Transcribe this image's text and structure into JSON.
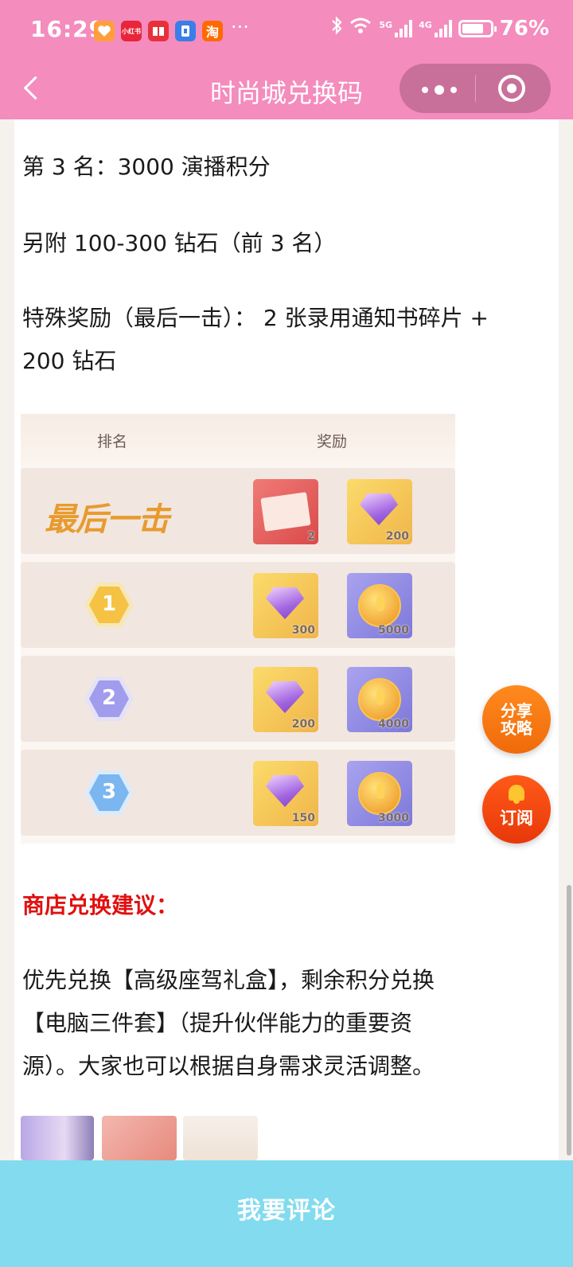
{
  "status_bar": {
    "time": "16:29",
    "apps": [
      "heart-app-icon",
      "xiaohongshu-app-icon",
      "book-app-icon",
      "doc-app-icon",
      "taobao-app-icon"
    ],
    "xiaohongshu_label": "小红书",
    "taobao_label": "淘",
    "more": "···",
    "network_5g": "5G",
    "network_4g": "4G",
    "battery": "76%"
  },
  "nav": {
    "title": "时尚城兑换码"
  },
  "article": {
    "line_rank3": "第 3 名：3000 演播积分",
    "line_extra": "另附 100-300 钻石（前 3 名）",
    "line_special_1": "特殊奖励（最后一击）： 2 张录用通知书碎片 +",
    "line_special_2": "200 钻石",
    "shop_heading": "商店兑换建议：",
    "advice_1": "优先兑换【高级座驾礼盒】，剩余积分兑换",
    "advice_2": "【电脑三件套】（提升伙伴能力的重要资",
    "advice_3": "源）。大家也可以根据自身需求灵活调整。"
  },
  "reward_table": {
    "header_rank": "排名",
    "header_reward": "奖励",
    "rows": [
      {
        "rank": "最后一击",
        "rewards": [
          {
            "item": "offer-fragment",
            "amount": "2"
          },
          {
            "item": "diamond",
            "amount": "200"
          }
        ]
      },
      {
        "rank": "1",
        "rewards": [
          {
            "item": "diamond",
            "amount": "300"
          },
          {
            "item": "coin",
            "amount": "5000"
          }
        ]
      },
      {
        "rank": "2",
        "rewards": [
          {
            "item": "diamond",
            "amount": "200"
          },
          {
            "item": "coin",
            "amount": "4000"
          }
        ]
      },
      {
        "rank": "3",
        "rewards": [
          {
            "item": "diamond",
            "amount": "150"
          },
          {
            "item": "coin",
            "amount": "3000"
          }
        ]
      }
    ]
  },
  "floating": {
    "share_line1": "分享",
    "share_line2": "攻略",
    "subscribe": "订阅"
  },
  "bottom": {
    "comment": "我要评论"
  },
  "colors": {
    "header_pink": "#f48cbd",
    "heading_red": "#e01010",
    "bottom_cyan": "#82dbef",
    "float_orange": "#f06a0a"
  }
}
